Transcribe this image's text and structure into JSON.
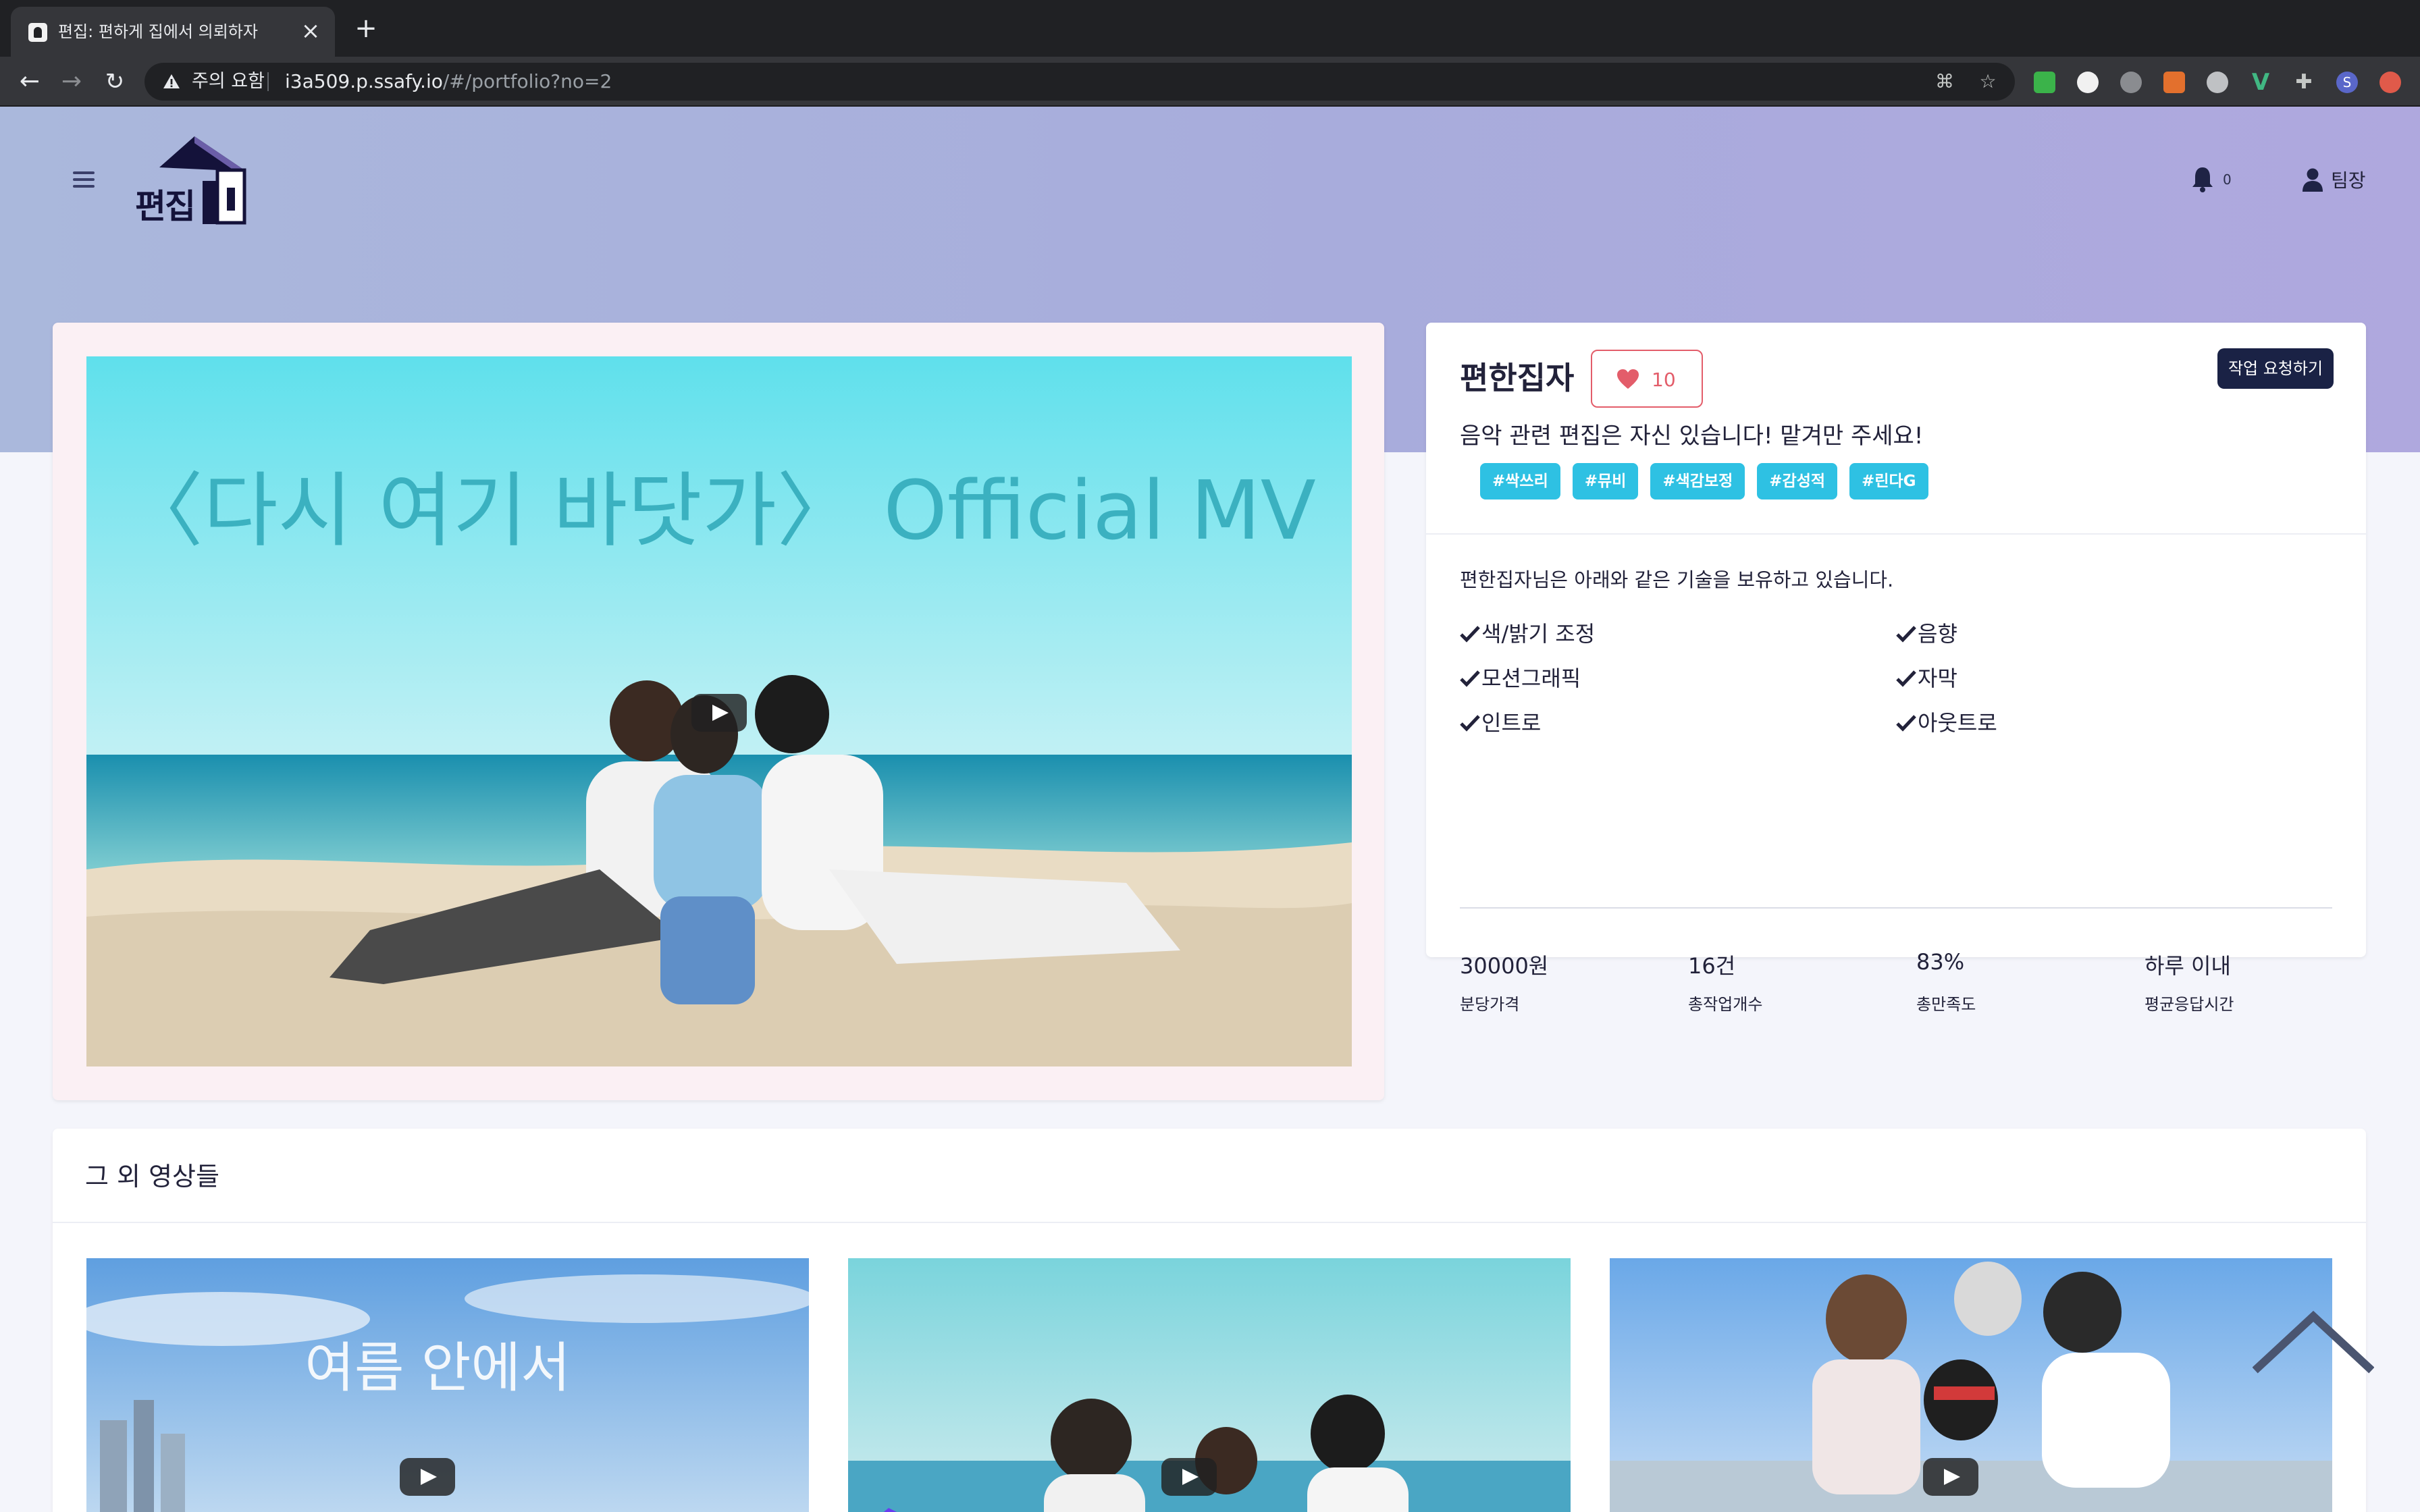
{
  "browser": {
    "tab_title": "편집: 편하게 집에서 의뢰하자",
    "security_label": "주의 요함",
    "url_host": "i3a509.p.ssafy.io",
    "url_path": "/#/portfolio?no=2"
  },
  "header": {
    "logo_text": "편집",
    "notification_count": "0",
    "user_name": "팀장"
  },
  "main_video": {
    "title_text": "〈다시 여기 바닷가〉 Official MV"
  },
  "editor": {
    "name": "편한집자",
    "likes": "10",
    "request_button": "작업 요청하기",
    "tagline": "음악 관련 편집은 자신 있습니다! 맡겨만 주세요!",
    "tags": [
      "#싹쓰리",
      "#뮤비",
      "#색감보정",
      "#감성적",
      "#린다G"
    ],
    "skills_intro": "편한집자님은 아래와 같은 기술을 보유하고 있습니다.",
    "skills": [
      "색/밝기 조정",
      "음향",
      "모션그래픽",
      "자막",
      "인트로",
      "아웃트로"
    ],
    "stats": [
      {
        "value": "30000원",
        "label": "분당가격"
      },
      {
        "value": "16건",
        "label": "총작업개수"
      },
      {
        "value": "83%",
        "label": "총만족도"
      },
      {
        "value": "하루 이내",
        "label": "평균응답시간"
      }
    ]
  },
  "others": {
    "title": "그 외 영상들",
    "thumb1_text": "여름 안에서"
  },
  "colors": {
    "accent_tag": "#2ec1e3",
    "like": "#e35d6a",
    "dark_button": "#1a2245",
    "hero_gradient": "#a8acdc"
  }
}
